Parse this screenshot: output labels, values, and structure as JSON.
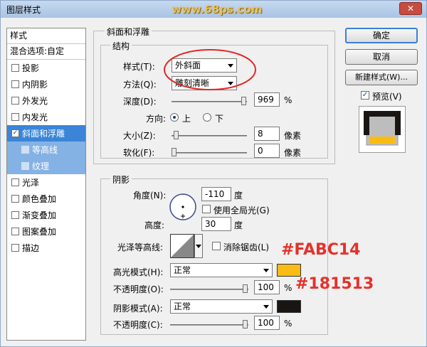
{
  "window": {
    "title": "图层样式",
    "watermark": "www.68ps.com",
    "close_label": "✕"
  },
  "left_panel": {
    "header": "样式",
    "blend_label": "混合选项:自定",
    "items": [
      {
        "label": "投影",
        "checked": false
      },
      {
        "label": "内阴影",
        "checked": false
      },
      {
        "label": "外发光",
        "checked": false
      },
      {
        "label": "内发光",
        "checked": false
      },
      {
        "label": "斜面和浮雕",
        "checked": true
      },
      {
        "label": "等高线",
        "checked": false
      },
      {
        "label": "纹理",
        "checked": false
      },
      {
        "label": "光泽",
        "checked": false
      },
      {
        "label": "颜色叠加",
        "checked": false
      },
      {
        "label": "渐变叠加",
        "checked": false
      },
      {
        "label": "图案叠加",
        "checked": false
      },
      {
        "label": "描边",
        "checked": false
      }
    ]
  },
  "bevel": {
    "group_title": "斜面和浮雕",
    "structure_title": "结构",
    "style_label": "样式(T):",
    "style_value": "外斜面",
    "technique_label": "方法(Q):",
    "technique_value": "雕刻清晰",
    "depth_label": "深度(D):",
    "depth_value": "969",
    "depth_unit": "%",
    "depth_level": 1.0,
    "direction_label": "方向:",
    "direction_up": "上",
    "direction_down": "下",
    "size_label": "大小(Z):",
    "size_value": "8",
    "size_unit": "像素",
    "size_level": 0.03,
    "soften_label": "软化(F):",
    "soften_value": "0",
    "soften_unit": "像素",
    "soften_level": 0.0
  },
  "shading": {
    "title": "阴影",
    "angle_label": "角度(N):",
    "angle_value": "-110",
    "angle_unit": "度",
    "global_light_label": "使用全局光(G)",
    "altitude_label": "高度:",
    "altitude_value": "30",
    "altitude_unit": "度",
    "gloss_label": "光泽等高线:",
    "antialias_label": "消除锯齿(L)",
    "highlight_label": "高光模式(H):",
    "highlight_value": "正常",
    "highlight_color": "#FABC14",
    "highlight_opacity_label": "不透明度(O):",
    "highlight_opacity_value": "100",
    "highlight_opacity_unit": "%",
    "highlight_opacity_level": 1.0,
    "shadow_label": "阴影模式(A):",
    "shadow_value": "正常",
    "shadow_color": "#181513",
    "shadow_opacity_label": "不透明度(C):",
    "shadow_opacity_value": "100",
    "shadow_opacity_unit": "%",
    "shadow_opacity_level": 1.0
  },
  "buttons": {
    "ok": "确定",
    "cancel": "取消",
    "new_style": "新建样式(W)...",
    "preview_label": "预览(V)"
  },
  "annotations": {
    "highlight_hex": "#FABC14",
    "shadow_hex": "#181513"
  }
}
